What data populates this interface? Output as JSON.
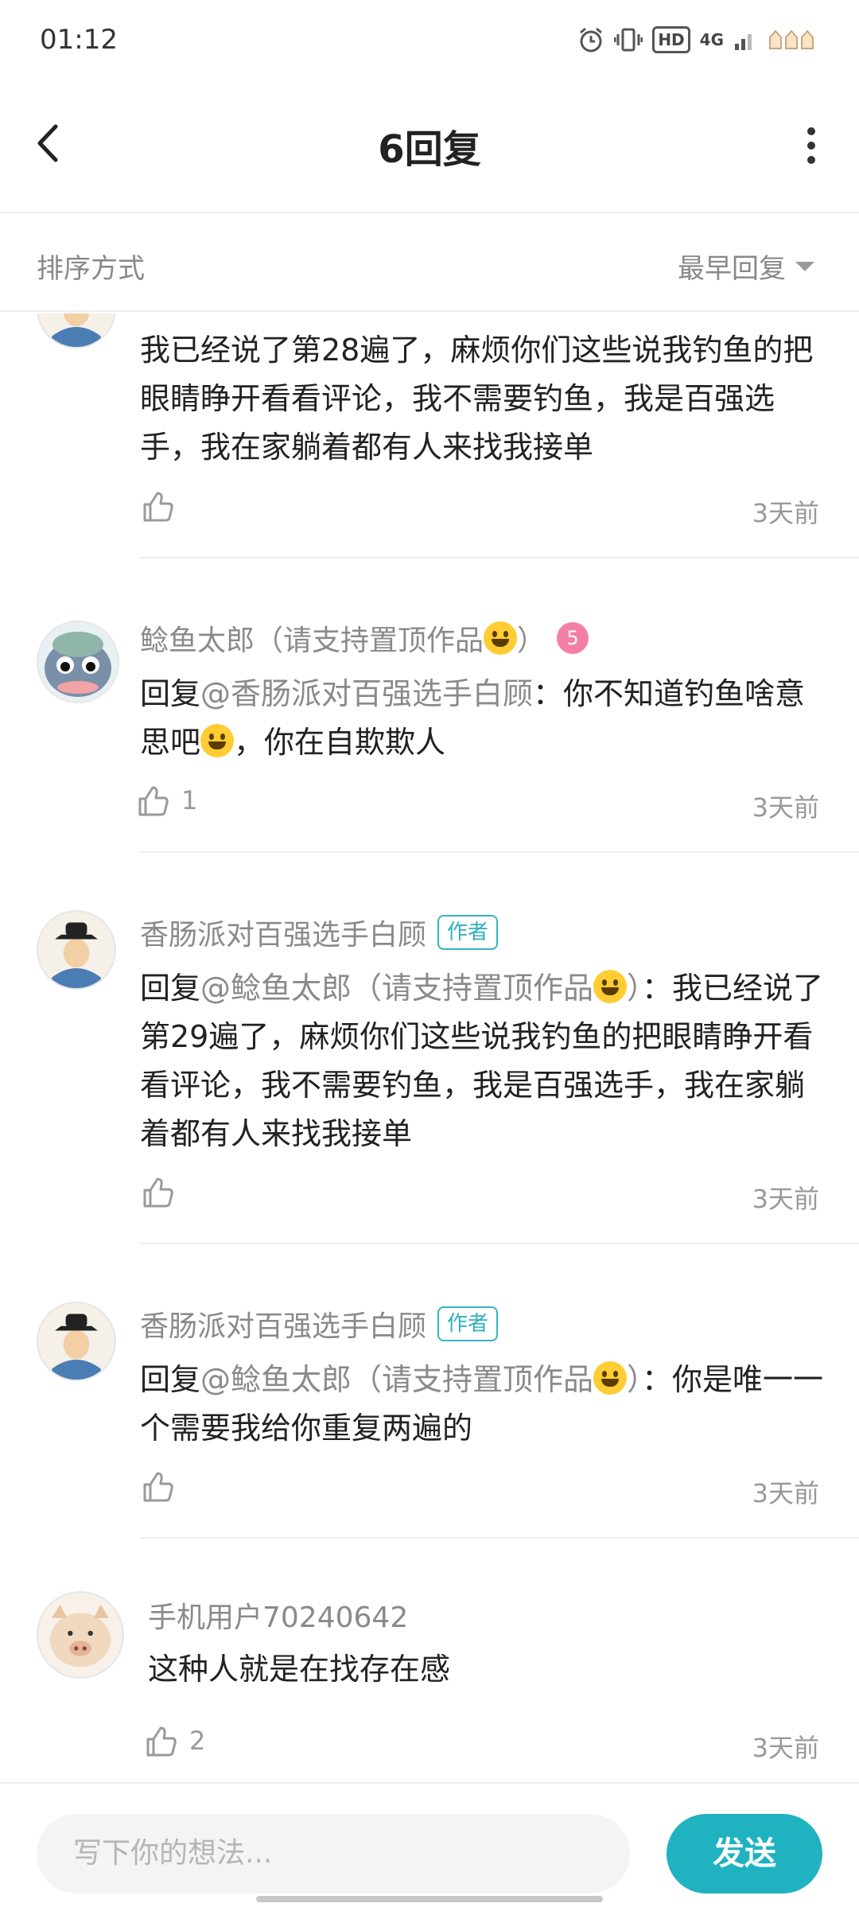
{
  "status_bar": {
    "time": "01:12",
    "hd": "HD",
    "network": "4G"
  },
  "header": {
    "title": "6回复"
  },
  "sort": {
    "label": "排序方式",
    "value": "最早回复"
  },
  "comments": [
    {
      "content": "我已经说了第28遍了，麻烦你们这些说我钓鱼的把眼睛睁开看看评论，我不需要钓鱼，我是百强选手，我在家躺着都有人来找我接单",
      "likes": "",
      "time": "3天前"
    },
    {
      "author": "鲶鱼太郎（请支持置顶作品",
      "author_suffix": "）",
      "level": "5",
      "reply_prefix": "回复",
      "mention": "@香肠派对百强选手白顾",
      "content_after_mention": "：你不知道钓鱼啥意思吧",
      "content_tail": "，你在自欺欺人",
      "likes": "1",
      "time": "3天前"
    },
    {
      "author": "香肠派对百强选手白顾",
      "badge": "作者",
      "reply_prefix": "回复",
      "mention": "@鲶鱼太郎（请支持置顶作品",
      "mention_suffix": "）",
      "content": "：我已经说了第29遍了，麻烦你们这些说我钓鱼的把眼睛睁开看看评论，我不需要钓鱼，我是百强选手，我在家躺着都有人来找我接单",
      "likes": "",
      "time": "3天前"
    },
    {
      "author": "香肠派对百强选手白顾",
      "badge": "作者",
      "reply_prefix": "回复",
      "mention": "@鲶鱼太郎（请支持置顶作品",
      "mention_suffix": "）",
      "content": "：你是唯一一个需要我给你重复两遍的",
      "likes": "",
      "time": "3天前"
    },
    {
      "author": "手机用户70240642",
      "content": "这种人就是在找存在感",
      "likes": "2",
      "time": "3天前"
    }
  ],
  "composer": {
    "placeholder": "写下你的想法...",
    "send_label": "发送"
  },
  "colors": {
    "accent": "#20b2c0",
    "author_badge": "#35b5c4",
    "level_badge": "#f47fa6"
  }
}
